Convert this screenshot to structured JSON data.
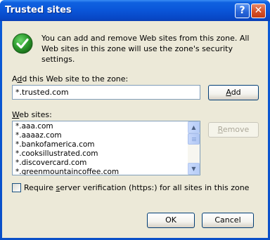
{
  "window": {
    "title": "Trusted sites",
    "help_glyph": "?",
    "close_glyph": "✕"
  },
  "info": {
    "icon": "green-check-icon",
    "text": "You can add and remove Web sites from this zone. All Web sites in this zone will use the zone's security settings."
  },
  "add": {
    "label_prefix": "A",
    "label_accel": "d",
    "label_rest": "d this Web site to the zone:",
    "input_value": "*.trusted.com",
    "button_accel": "A",
    "button_rest": "dd"
  },
  "sites": {
    "label_accel": "W",
    "label_rest": "eb sites:",
    "items": [
      "*.aaa.com",
      "*.aaaaz.com",
      "*.bankofamerica.com",
      "*.cooksillustrated.com",
      "*.discovercard.com",
      "*.greenmountaincoffee.com"
    ],
    "remove_accel": "R",
    "remove_rest": "emove",
    "remove_enabled": false
  },
  "verification": {
    "checked": false,
    "label_prefix": "Require ",
    "label_accel": "s",
    "label_rest": "erver verification (https:) for all sites in this zone"
  },
  "footer": {
    "ok_label": "OK",
    "cancel_label": "Cancel"
  },
  "colors": {
    "title_bar": "#0a55d8",
    "dialog_bg": "#ece9d8",
    "check_green": "#2e9b2e"
  }
}
